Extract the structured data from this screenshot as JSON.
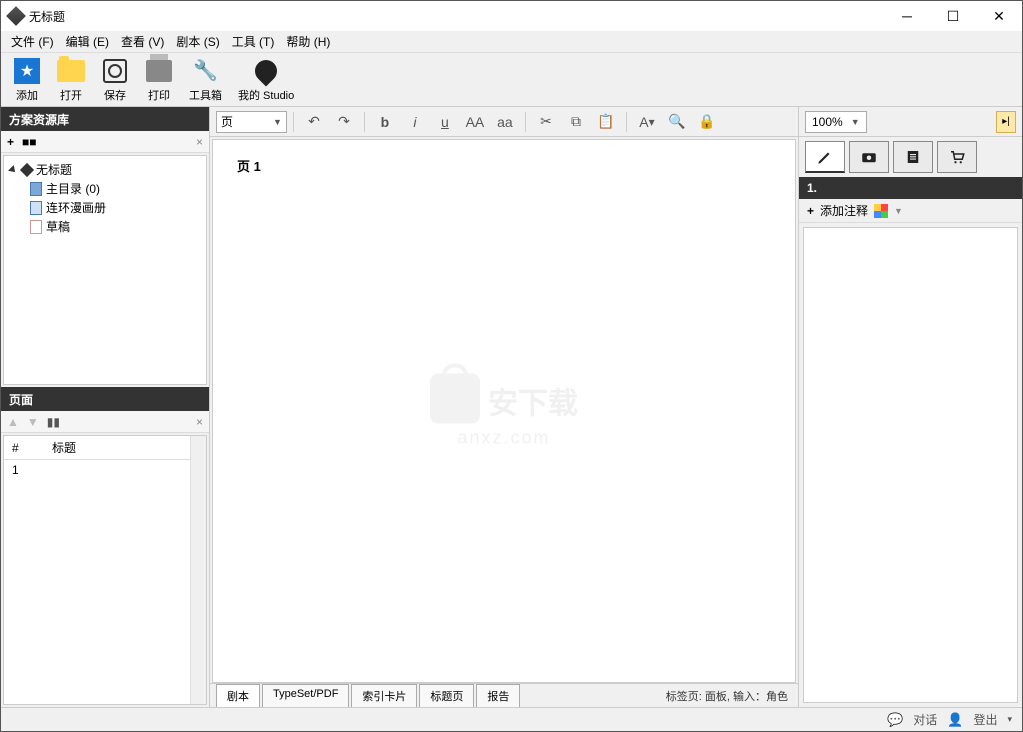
{
  "window": {
    "title": "无标题"
  },
  "menu": {
    "items": [
      "文件 (F)",
      "编辑 (E)",
      "查看 (V)",
      "剧本 (S)",
      "工具 (T)",
      "帮助 (H)"
    ]
  },
  "toolbar": {
    "add": "添加",
    "open": "打开",
    "save": "保存",
    "print": "打印",
    "toolbox": "工具箱",
    "studio": "我的 Studio"
  },
  "left": {
    "resources_title": "方案资源库",
    "tree": {
      "root": "无标题",
      "main_dir": "主目录 (0)",
      "comic": "连环漫画册",
      "draft": "草稿"
    },
    "pages_title": "页面",
    "table": {
      "col_num": "#",
      "col_title": "标题",
      "row1_num": "1"
    }
  },
  "format": {
    "selector": "页",
    "zoom": "100%"
  },
  "editor": {
    "page_label": "页  1"
  },
  "watermark": {
    "zh": "安下载",
    "en": "anxz.com"
  },
  "bottom_tabs": {
    "script": "剧本",
    "typeset": "TypeSet/PDF",
    "index": "索引卡片",
    "title_page": "标题页",
    "report": "报告",
    "info": "标签页: 面板, 输入：角色"
  },
  "right": {
    "note_header": "1.",
    "add_note": "添加注释"
  },
  "status": {
    "chat": "对话",
    "logout": "登出"
  }
}
